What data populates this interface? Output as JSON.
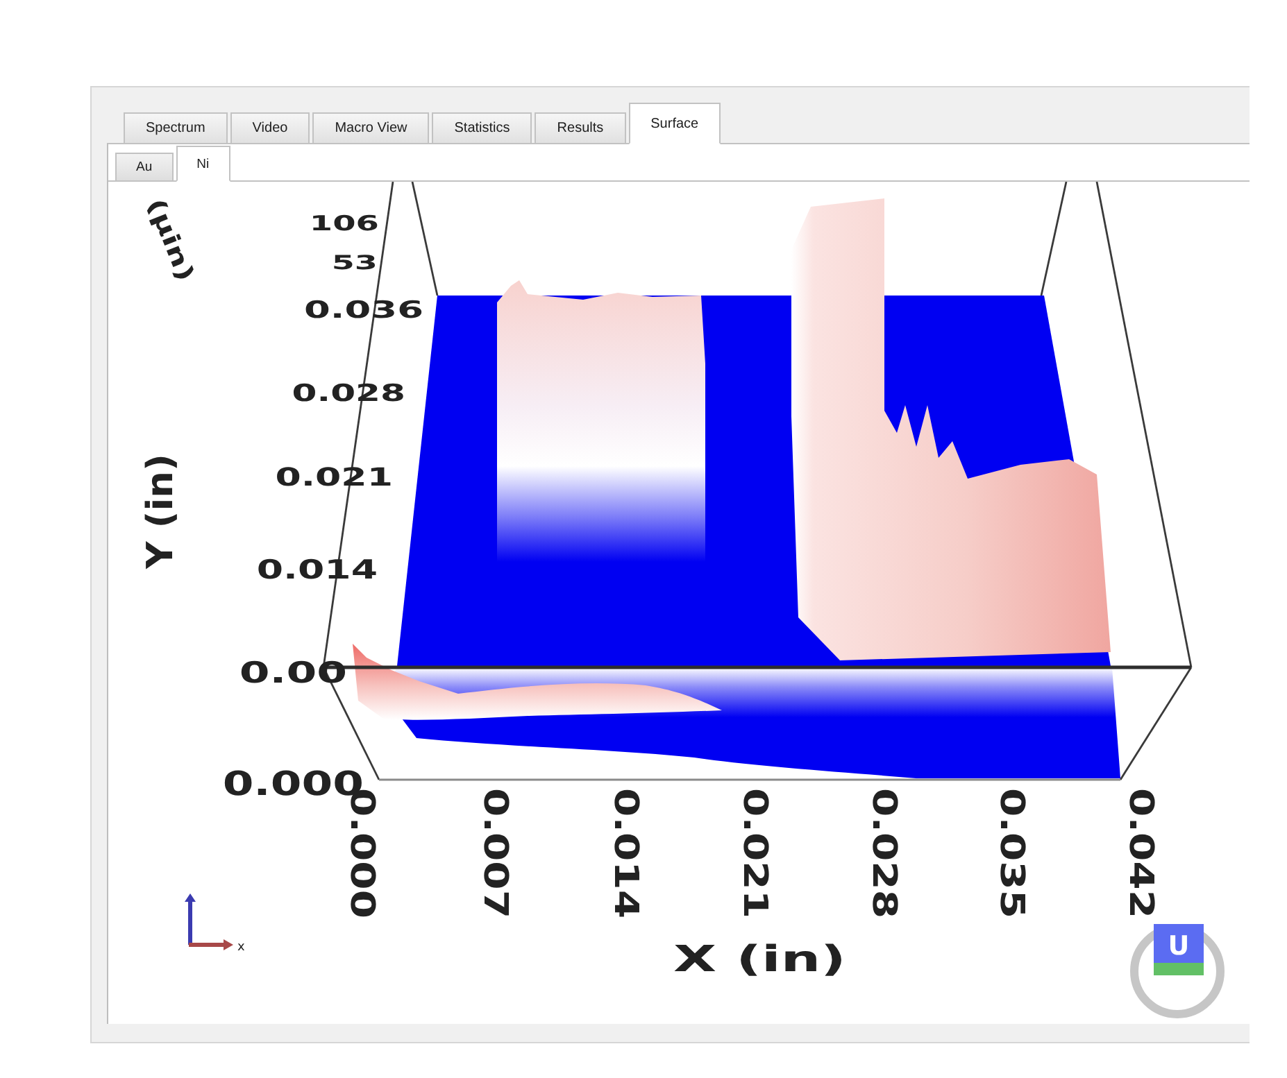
{
  "tabs": [
    {
      "label": "Spectrum",
      "selected": false
    },
    {
      "label": "Video",
      "selected": false
    },
    {
      "label": "Macro View",
      "selected": false
    },
    {
      "label": "Statistics",
      "selected": false
    },
    {
      "label": "Results",
      "selected": false
    },
    {
      "label": "Surface",
      "selected": true
    }
  ],
  "subtabs": [
    {
      "label": "Au",
      "selected": false
    },
    {
      "label": "Ni",
      "selected": true
    }
  ],
  "plot": {
    "z_axis": {
      "title": "(µin)",
      "ticks": [
        "106",
        "53"
      ]
    },
    "y_axis": {
      "title": "Y (in)",
      "ticks": [
        "0.036",
        "0.028",
        "0.021",
        "0.014",
        "0.00",
        "0.000"
      ]
    },
    "x_axis": {
      "title": "X (in)",
      "ticks": [
        "0.000",
        "0.007",
        "0.014",
        "0.021",
        "0.028",
        "0.035",
        "0.042"
      ]
    },
    "triad": {
      "label": "x"
    }
  },
  "logo": {
    "letter": "U"
  }
}
